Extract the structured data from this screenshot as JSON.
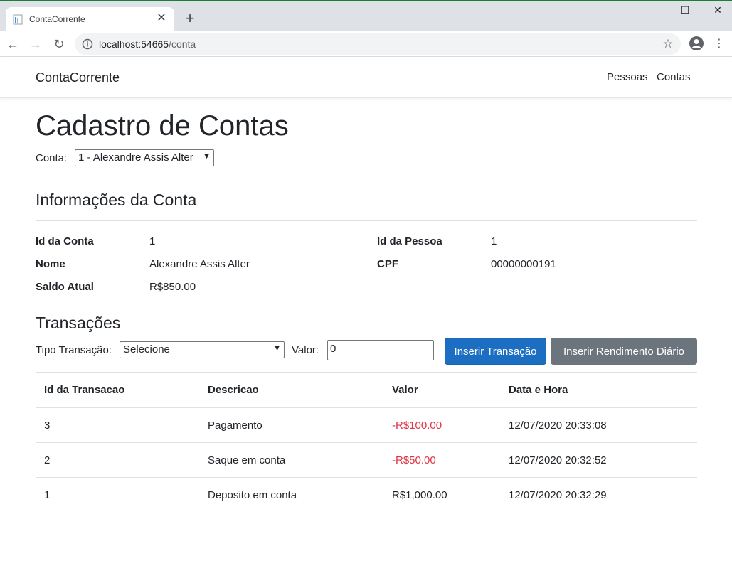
{
  "browser": {
    "tab_title": "ContaCorrente",
    "url_host": "localhost:54665",
    "url_path": "/conta"
  },
  "navbar": {
    "brand": "ContaCorrente",
    "links": [
      "Pessoas",
      "Contas"
    ]
  },
  "page": {
    "title": "Cadastro de Contas",
    "conta_label": "Conta:",
    "conta_selected": "1 - Alexandre Assis Alter"
  },
  "info": {
    "heading": "Informações da Conta",
    "id_conta_label": "Id da Conta",
    "id_conta_value": "1",
    "nome_label": "Nome",
    "nome_value": "Alexandre Assis Alter",
    "saldo_label": "Saldo Atual",
    "saldo_value": "R$850.00",
    "id_pessoa_label": "Id da Pessoa",
    "id_pessoa_value": "1",
    "cpf_label": "CPF",
    "cpf_value": "00000000191"
  },
  "transacoes": {
    "heading": "Transações",
    "tipo_label": "Tipo Transação:",
    "tipo_selected": "Selecione",
    "valor_label": "Valor:",
    "valor_value": "0",
    "inserir_label": "Inserir Transação",
    "rendimento_label": "Inserir Rendimento Diário",
    "columns": [
      "Id da Transacao",
      "Descricao",
      "Valor",
      "Data e Hora"
    ],
    "rows": [
      {
        "id": "3",
        "descricao": "Pagamento",
        "valor": "-R$100.00",
        "data": "12/07/2020 20:33:08"
      },
      {
        "id": "2",
        "descricao": "Saque em conta",
        "valor": "-R$50.00",
        "data": "12/07/2020 20:32:52"
      },
      {
        "id": "1",
        "descricao": "Deposito em conta",
        "valor": "R$1,000.00",
        "data": "12/07/2020 20:32:29"
      }
    ]
  },
  "colors": {
    "primary": "#1b6ec2",
    "secondary": "#6c757d",
    "negative": "#dc3545"
  }
}
